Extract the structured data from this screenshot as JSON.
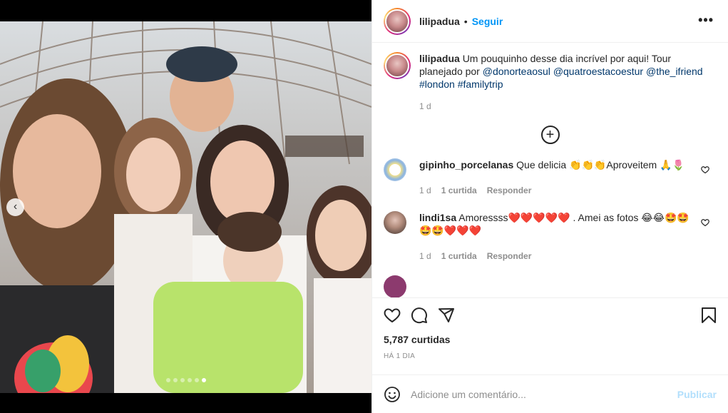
{
  "post": {
    "username": "lilipadua",
    "separator": "•",
    "follow_label": "Seguir",
    "more_label": "•••"
  },
  "caption": {
    "username": "lilipadua",
    "text": "Um pouquinho desse dia incrível por aqui! Tour planejado por",
    "mentions": [
      "@donorteaosul",
      "@quatroestacoestur",
      "@the_ifriend"
    ],
    "hashtags": [
      "#london",
      "#familytrip"
    ],
    "time": "1 d"
  },
  "load_more_label": "+",
  "comments": [
    {
      "username": "gipinho_porcelanas",
      "text": "Que delicia 👏👏👏Aproveitem 🙏🌷",
      "time": "1 d",
      "likes": "1 curtida",
      "reply_label": "Responder"
    },
    {
      "username": "lindi1sa",
      "text": "Amoressss❤️❤️❤️❤️❤️ . Amei as fotos 😂😂🤩🤩🤩🤩❤️❤️❤️",
      "time": "1 d",
      "likes": "1 curtida",
      "reply_label": "Responder"
    }
  ],
  "likes_count": "5,787 curtidas",
  "post_date": "HÁ 1 DIA",
  "add_comment": {
    "placeholder": "Adicione um comentário...",
    "publish_label": "Publicar"
  },
  "carousel": {
    "total": 6,
    "active_index": 5,
    "prev_label": "‹"
  },
  "colors": {
    "accent": "#0095f6",
    "publish_disabled": "#b2dffc",
    "link": "#00376b",
    "muted": "#8e8e8e",
    "heart_red": "#e0245e"
  },
  "icons": {
    "like": "heart-icon",
    "comment": "comment-bubble-icon",
    "share": "paper-plane-icon",
    "save": "bookmark-icon",
    "emoji": "smiley-icon",
    "more": "ellipsis-icon",
    "load_more": "plus-circle-icon",
    "prev": "chevron-left-icon"
  }
}
